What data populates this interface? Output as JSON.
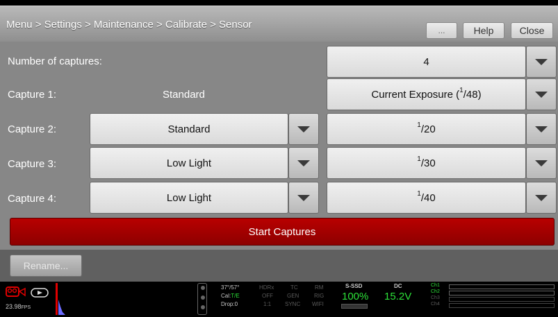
{
  "header": {
    "breadcrumb": "Menu > Settings > Maintenance > Calibrate > Sensor",
    "more_label": "...",
    "help_label": "Help",
    "close_label": "Close"
  },
  "rows": {
    "num_captures": {
      "label": "Number of captures:",
      "value": "4"
    },
    "capture1": {
      "label": "Capture 1:",
      "mode": "Standard",
      "exposure_prefix": "Current Exposure (",
      "exposure_num": "1",
      "exposure_den": "48",
      "exposure_suffix": ")"
    },
    "capture2": {
      "label": "Capture 2:",
      "mode": "Standard",
      "exposure_num": "1",
      "exposure_den": "20"
    },
    "capture3": {
      "label": "Capture 3:",
      "mode": "Low Light",
      "exposure_num": "1",
      "exposure_den": "30"
    },
    "capture4": {
      "label": "Capture 4:",
      "mode": "Low Light",
      "exposure_num": "1",
      "exposure_den": "40"
    }
  },
  "actions": {
    "start_label": "Start Captures",
    "rename_label": "Rename..."
  },
  "status": {
    "fps": "23.98",
    "fps_unit": "FPS",
    "angle": "37°/57°",
    "cal_label": "Cal:",
    "cal_value": "T/E",
    "drop": "Drop:0",
    "hdrx": "HDRx",
    "hdrx_val": "OFF",
    "ratio": "1:1",
    "tc": "TC",
    "gen": "GEN",
    "sync": "SYNC",
    "rm": "RM",
    "rig": "RIG",
    "wifi": "WIFI",
    "media": "S-SSD",
    "media_pct": "100%",
    "power": "DC",
    "voltage": "15.2V",
    "ch1": "Ch1",
    "ch2": "Ch2",
    "ch3": "Ch3",
    "ch4": "Ch4",
    "colors": {
      "green": "#2ce038",
      "red": "#e00000",
      "accent_red": "#a30000"
    }
  }
}
